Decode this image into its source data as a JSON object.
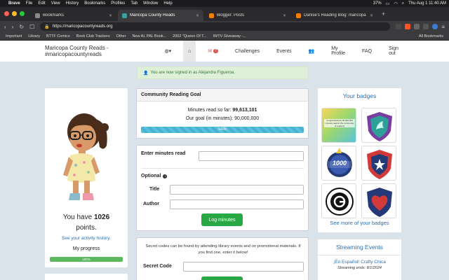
{
  "menubar": {
    "app": "Brave",
    "items": [
      "File",
      "Edit",
      "View",
      "History",
      "Bookmarks",
      "Profiles",
      "Tab",
      "Window",
      "Help"
    ],
    "battery": "37%",
    "datetime": "Thu Aug 1  11:40 AM"
  },
  "tabs": [
    {
      "title": "Bookmarks",
      "color": "#8a8a8a",
      "active": false
    },
    {
      "title": "Maricopa County Reads",
      "color": "#3aa0a0",
      "active": true
    },
    {
      "title": "Blogger: Posts",
      "color": "#f57d00",
      "active": false
    },
    {
      "title": "Danise's Reading Blog: maricopa",
      "color": "#f57d00",
      "active": false
    }
  ],
  "address": {
    "url": "https://maricopacountyreads.org"
  },
  "bookmarks": [
    "Important",
    "Library",
    "BTTF Comics",
    "Book Club Trackers",
    "Other",
    "New AL PAL Book...",
    "2002 \"Queen Of T...",
    "IWTV Giveaway -...",
    "All Bookmarks"
  ],
  "navbar": {
    "brand": "Maricopa County Reads - #maricopacountyreads",
    "globe_caret": "▾",
    "mail_count": "7",
    "challenges": "Challenges",
    "events": "Events",
    "my_profile": "My Profile",
    "faq": "FAQ",
    "sign_out": "Sign out"
  },
  "alert": {
    "text": "You are now signed in as Alejandra Figueroa."
  },
  "profile": {
    "you_have": "You have",
    "points_value": "1026",
    "points_suffix": "points.",
    "activity_link": "See your activity history.",
    "progress_label": "My progress",
    "progress_text": "100%",
    "progress_fraction": 1.0
  },
  "goal": {
    "title": "Community Reading Goal",
    "minutes_label": "Minutes read so far:",
    "minutes_value": "99,613,101",
    "goal_label": "Our goal (in minutes): 90,000,000",
    "bar_text": "100%",
    "progress_fraction": 1.0
  },
  "log_form": {
    "minutes_label": "Enter minutes read",
    "optional_label": "Optional",
    "title_label": "Title",
    "author_label": "Author",
    "submit": "Log minutes"
  },
  "secret": {
    "description": "Secret codes can be found by attending library events and on promotional materials. If you find one, enter it below!",
    "label": "Secret Code"
  },
  "badges": {
    "title": "Your badges",
    "tile_text": "Congratulations! 90,000,000 minutes read at the community of readers!",
    "badge_1000": "1000",
    "more_link": "See more of your badges",
    "colors": {
      "purple": "#7a3da0",
      "red": "#d23a3a",
      "teal": "#2f9f9a",
      "navy": "#243a78"
    }
  },
  "streaming": {
    "title": "Streaming Events",
    "event_title": "¡En Español! Crafty Chica",
    "event_ends": "Streaming ends: 8/1/2024"
  },
  "colors": {
    "accent_blue": "#2a6fb3",
    "success_green": "#28a745",
    "progress_green": "#5cb85c",
    "info_blue": "#5bc0de"
  }
}
